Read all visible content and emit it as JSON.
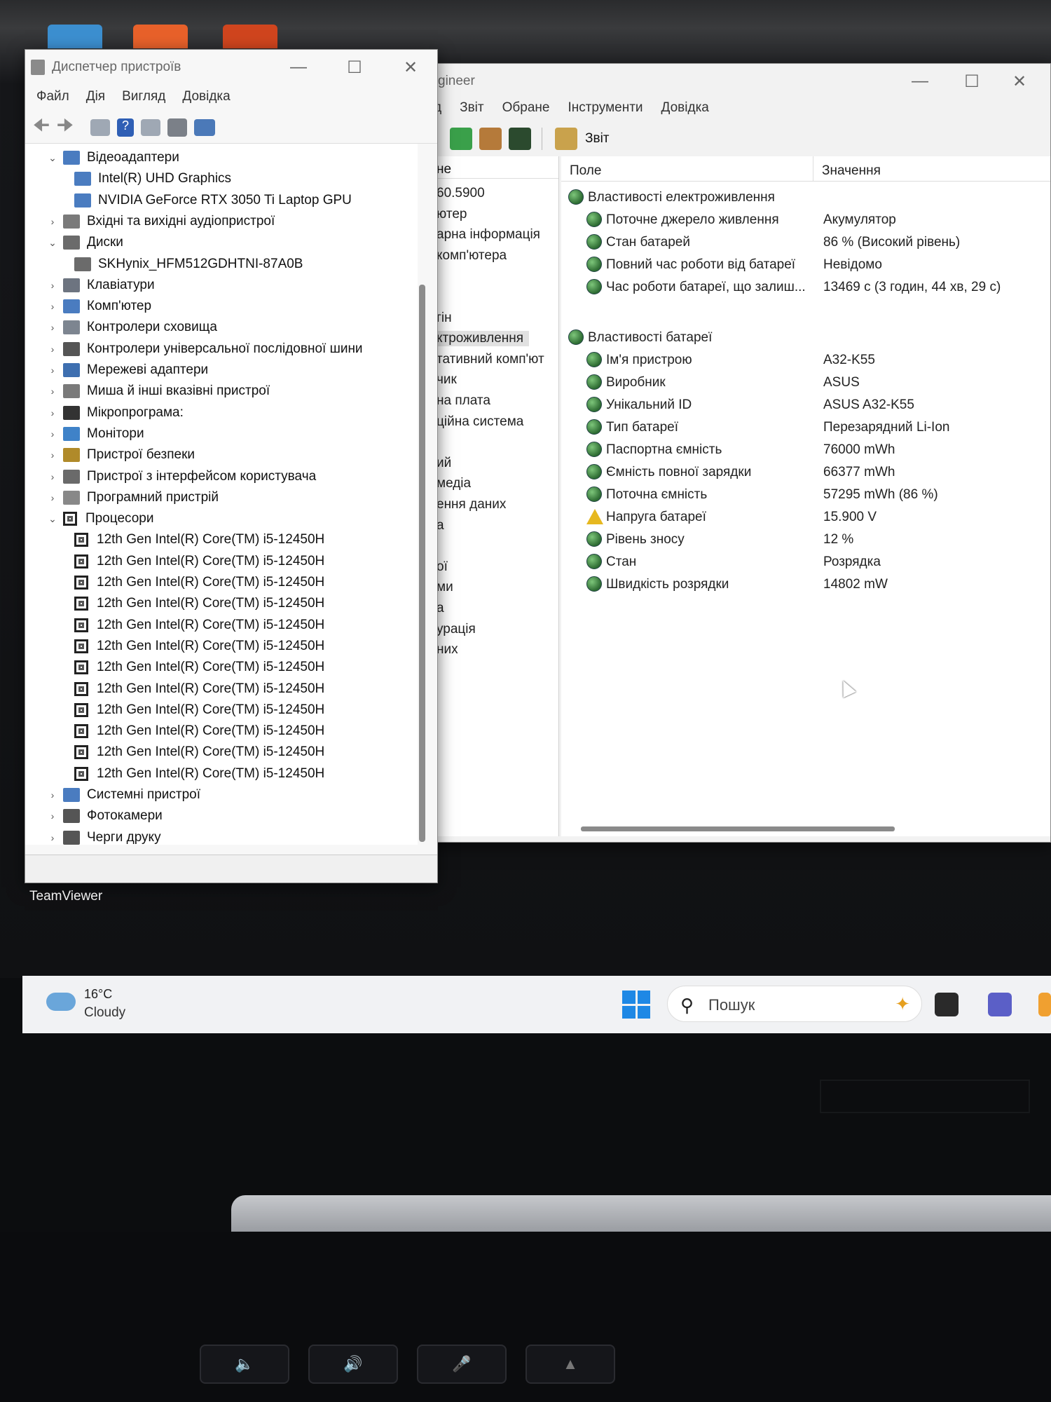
{
  "device_manager": {
    "title": "Диспетчер пристроїв",
    "menu": [
      "Файл",
      "Дія",
      "Вигляд",
      "Довідка"
    ],
    "tree": [
      {
        "label": "Відеоадаптери",
        "expanded": true,
        "level": 0,
        "icon": "display-adapter-icon"
      },
      {
        "label": "Intel(R) UHD Graphics",
        "level": 1,
        "icon": "display-adapter-icon"
      },
      {
        "label": "NVIDIA GeForce RTX 3050 Ti Laptop GPU",
        "level": 1,
        "icon": "display-adapter-icon"
      },
      {
        "label": "Вхідні та вихідні аудіопристрої",
        "expanded": false,
        "level": 0,
        "icon": "speaker-icon"
      },
      {
        "label": "Диски",
        "expanded": true,
        "level": 0,
        "icon": "disk-drive-icon"
      },
      {
        "label": "SKHynix_HFM512GDHTNI-87A0B",
        "level": 1,
        "icon": "disk-drive-icon"
      },
      {
        "label": "Клавіатури",
        "expanded": false,
        "level": 0,
        "icon": "keyboard-icon"
      },
      {
        "label": "Комп'ютер",
        "expanded": false,
        "level": 0,
        "icon": "computer-icon"
      },
      {
        "label": "Контролери сховища",
        "expanded": false,
        "level": 0,
        "icon": "storage-controller-icon"
      },
      {
        "label": "Контролери універсальної послідовної шини",
        "expanded": false,
        "level": 0,
        "icon": "usb-icon"
      },
      {
        "label": "Мережеві адаптери",
        "expanded": false,
        "level": 0,
        "icon": "network-adapter-icon"
      },
      {
        "label": "Миша й інші вказівні пристрої",
        "expanded": false,
        "level": 0,
        "icon": "mouse-icon"
      },
      {
        "label": "Мікропрограма:",
        "expanded": false,
        "level": 0,
        "icon": "firmware-icon"
      },
      {
        "label": "Монітори",
        "expanded": false,
        "level": 0,
        "icon": "monitor-icon"
      },
      {
        "label": "Пристрої безпеки",
        "expanded": false,
        "level": 0,
        "icon": "security-device-icon"
      },
      {
        "label": "Пристрої з інтерфейсом користувача",
        "expanded": false,
        "level": 0,
        "icon": "hid-icon"
      },
      {
        "label": "Програмний пристрій",
        "expanded": false,
        "level": 0,
        "icon": "software-device-icon"
      },
      {
        "label": "Процесори",
        "expanded": true,
        "level": 0,
        "icon": "processor-icon"
      },
      {
        "label": "12th Gen Intel(R) Core(TM) i5-12450H",
        "level": 1,
        "icon": "processor-icon"
      },
      {
        "label": "12th Gen Intel(R) Core(TM) i5-12450H",
        "level": 1,
        "icon": "processor-icon"
      },
      {
        "label": "12th Gen Intel(R) Core(TM) i5-12450H",
        "level": 1,
        "icon": "processor-icon"
      },
      {
        "label": "12th Gen Intel(R) Core(TM) i5-12450H",
        "level": 1,
        "icon": "processor-icon"
      },
      {
        "label": "12th Gen Intel(R) Core(TM) i5-12450H",
        "level": 1,
        "icon": "processor-icon"
      },
      {
        "label": "12th Gen Intel(R) Core(TM) i5-12450H",
        "level": 1,
        "icon": "processor-icon"
      },
      {
        "label": "12th Gen Intel(R) Core(TM) i5-12450H",
        "level": 1,
        "icon": "processor-icon"
      },
      {
        "label": "12th Gen Intel(R) Core(TM) i5-12450H",
        "level": 1,
        "icon": "processor-icon"
      },
      {
        "label": "12th Gen Intel(R) Core(TM) i5-12450H",
        "level": 1,
        "icon": "processor-icon"
      },
      {
        "label": "12th Gen Intel(R) Core(TM) i5-12450H",
        "level": 1,
        "icon": "processor-icon"
      },
      {
        "label": "12th Gen Intel(R) Core(TM) i5-12450H",
        "level": 1,
        "icon": "processor-icon"
      },
      {
        "label": "12th Gen Intel(R) Core(TM) i5-12450H",
        "level": 1,
        "icon": "processor-icon"
      },
      {
        "label": "Системні пристрої",
        "expanded": false,
        "level": 0,
        "icon": "system-device-icon"
      },
      {
        "label": "Фотокамери",
        "expanded": false,
        "level": 0,
        "icon": "camera-icon"
      },
      {
        "label": "Черги друку",
        "expanded": false,
        "level": 0,
        "icon": "printer-icon"
      }
    ]
  },
  "aida": {
    "title_fragment": "gineer",
    "menu": [
      "д",
      "Звіт",
      "Обране",
      "Інструменти",
      "Довідка"
    ],
    "toolbar_report": "Звіт",
    "left_header": "не",
    "left_items": [
      "60.5900",
      "ютер",
      "арна інформація",
      "комп'ютера",
      "",
      "",
      "гін",
      "ктроживлення",
      "тативний комп'ют",
      "чик",
      "на плата",
      "ційна система",
      "",
      "ий",
      "медіа",
      "ення даних",
      "а",
      "",
      "ої",
      "ми",
      "а",
      "урація",
      "них"
    ],
    "left_selected_index": 7,
    "col_field": "Поле",
    "col_value": "Значення",
    "sections": [
      {
        "title": "Властивості електроживлення",
        "rows": [
          {
            "field": "Поточне джерело живлення",
            "value": "Акумулятор"
          },
          {
            "field": "Стан батарей",
            "value": "86 % (Високий рівень)"
          },
          {
            "field": "Повний час роботи від батареї",
            "value": "Невідомо"
          },
          {
            "field": "Час роботи батареї, що залиш...",
            "value": "13469 с (3 годин, 44 хв, 29 с)"
          }
        ]
      },
      {
        "title": "Властивості батареї",
        "rows": [
          {
            "field": "Ім'я пристрою",
            "value": "A32-K55"
          },
          {
            "field": "Виробник",
            "value": "ASUS"
          },
          {
            "field": "Унікальний ID",
            "value": "ASUS A32-K55"
          },
          {
            "field": "Тип батареї",
            "value": "Перезарядний Li-Ion"
          },
          {
            "field": "Паспортна ємність",
            "value": "76000 mWh"
          },
          {
            "field": "Ємність повної зарядки",
            "value": "66377 mWh"
          },
          {
            "field": "Поточна ємність",
            "value": "57295 mWh  (86 %)"
          },
          {
            "field": "Напруга батареї",
            "value": "15.900 V",
            "warning": true
          },
          {
            "field": "Рівень зносу",
            "value": "12 %"
          },
          {
            "field": "Стан",
            "value": "Розрядка"
          },
          {
            "field": "Швидкість розрядки",
            "value": "14802 mW"
          }
        ]
      }
    ]
  },
  "desktop": {
    "icon_label": "TeamViewer"
  },
  "taskbar": {
    "weather_temp": "16°C",
    "weather_desc": "Cloudy",
    "search_placeholder": "Пошук"
  },
  "colors": {
    "accent": "#1e88e5",
    "selection": "#e1e1e1",
    "warning": "#e6b820"
  }
}
